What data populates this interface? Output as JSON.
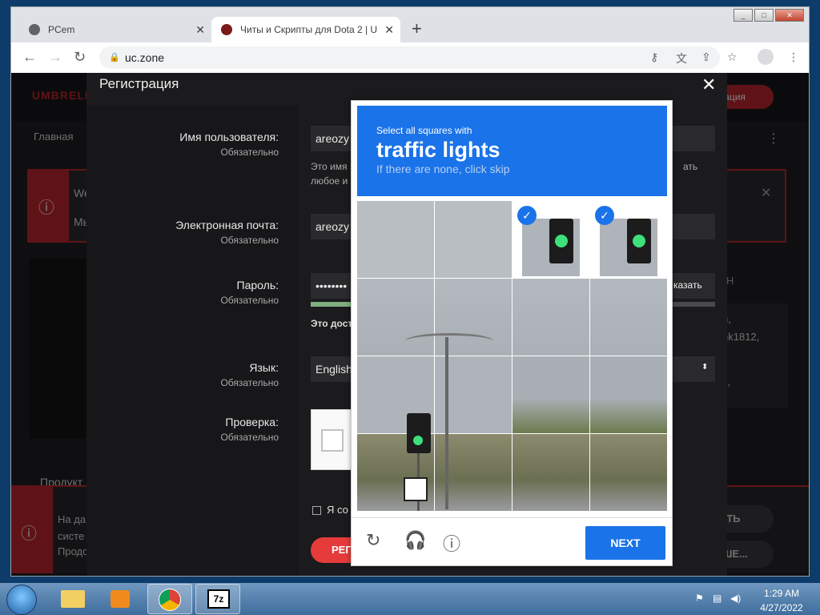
{
  "browser": {
    "tabs": [
      {
        "title": "PCem"
      },
      {
        "title": "Читы и Скрипты для Dota 2 | U"
      }
    ],
    "new_tab": "+",
    "url": "uc.zone"
  },
  "site": {
    "logo": "UMBRELL",
    "register_pill": "страция",
    "nav_home": "Главная",
    "alert_top_line1": "We",
    "alert_top_line2": "Мы",
    "side_right_text1": "Н",
    "side_right_text2": "й,",
    "side_right_text3": "nk1812,",
    "side_right_text4": "э,",
    "products_label": "Продукт",
    "alert_bottom_line1": "На да",
    "alert_bottom_line2": "систе",
    "alert_bottom_line3": "Продо",
    "btn_right1": "ЯТЬ",
    "btn_right2": "ЬШЕ..."
  },
  "modal": {
    "title": "Регистрация",
    "required": "Обязательно",
    "username_label": "Имя пользователя:",
    "username_value": "areozy",
    "username_hint1": "Это имя",
    "username_hint2": "любое и",
    "username_hint_right": "ать",
    "email_label": "Электронная почта:",
    "email_value": "areozy",
    "password_label": "Пароль:",
    "password_value": "••••••••",
    "password_show": "казать",
    "password_hint": "Это дост",
    "language_label": "Язык:",
    "language_value": "English",
    "check_label": "Проверка:",
    "agree_text": "Я со",
    "submit_text": "РЕГ"
  },
  "captcha": {
    "instruction": "Select all squares with",
    "target": "traffic lights",
    "subtext": "If there are none, click skip",
    "selected_cells": [
      2,
      3
    ],
    "next": "NEXT"
  },
  "taskbar": {
    "time": "1:29 AM",
    "date": "4/27/2022",
    "icons": [
      "folder-icon",
      "media-player-icon",
      "chrome-icon",
      "7zip-icon"
    ]
  }
}
